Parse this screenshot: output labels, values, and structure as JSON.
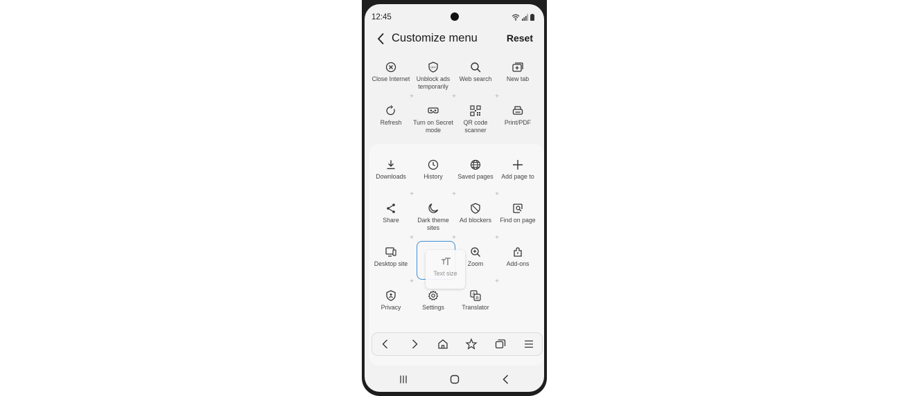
{
  "status": {
    "time": "12:45"
  },
  "header": {
    "title": "Customize menu",
    "reset_label": "Reset"
  },
  "menu_top": [
    {
      "label": "Close Internet",
      "icon": "close-circle-icon"
    },
    {
      "label": "Unblock ads temporarily",
      "icon": "shield-off-icon"
    },
    {
      "label": "Web search",
      "icon": "search-icon"
    },
    {
      "label": "New tab",
      "icon": "new-tab-icon"
    },
    {
      "label": "Refresh",
      "icon": "refresh-icon"
    },
    {
      "label": "Turn on Secret mode",
      "icon": "secret-mode-icon"
    },
    {
      "label": "QR code scanner",
      "icon": "qr-code-icon"
    },
    {
      "label": "Print/PDF",
      "icon": "print-icon"
    }
  ],
  "menu_panel": [
    {
      "label": "Downloads",
      "icon": "download-icon"
    },
    {
      "label": "History",
      "icon": "clock-icon"
    },
    {
      "label": "Saved pages",
      "icon": "globe-icon"
    },
    {
      "label": "Add page to",
      "icon": "plus-icon"
    },
    {
      "label": "Share",
      "icon": "share-icon"
    },
    {
      "label": "Dark theme sites",
      "icon": "moon-icon"
    },
    {
      "label": "Ad blockers",
      "icon": "shield-icon"
    },
    {
      "label": "Find on page",
      "icon": "find-page-icon"
    },
    {
      "label": "Desktop site",
      "icon": "desktop-icon"
    },
    {
      "label": "Zoom",
      "icon": "zoom-icon"
    },
    {
      "label": "Add-ons",
      "icon": "addons-icon"
    },
    {
      "label": "Privacy",
      "icon": "privacy-icon"
    },
    {
      "label": "Settings",
      "icon": "gear-icon"
    },
    {
      "label": "Translator",
      "icon": "translate-icon"
    }
  ],
  "dragging": {
    "label": "Text size",
    "icon": "text-size-icon"
  },
  "bottom_bar": [
    "back-icon",
    "forward-icon",
    "home-icon",
    "bookmark-star-icon",
    "tabs-icon",
    "menu-icon"
  ],
  "system_nav": [
    "recents-icon",
    "home-nav-icon",
    "back-nav-icon"
  ]
}
